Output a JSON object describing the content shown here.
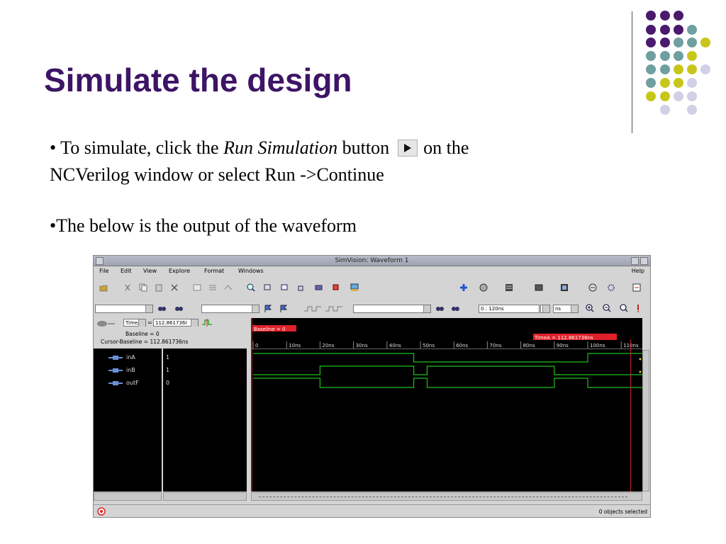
{
  "slide": {
    "title": "Simulate the design",
    "bullet1": {
      "prefix": "• To simulate, click the ",
      "emphasis": "Run Simulation",
      "middle": " button",
      "suffix": "on the",
      "line2": "NCVerilog window or select Run ->Continue"
    },
    "bullet2": "•The below is the output of the waveform"
  },
  "window": {
    "title": "SimVision: Waveform 1",
    "menus": [
      "File",
      "Edit",
      "View",
      "Explore",
      "Format",
      "Windows"
    ],
    "help": "Help",
    "time_range": "0 : 120ns",
    "time_unit": "ns",
    "cursor_select": "TimeA",
    "cursor_value": "112.861736r",
    "baseline_row": "Baseline = 0",
    "cursor_baseline_row": "Cursor-Baseline = 112.861736ns",
    "baseline_flag": "Baseline = 0",
    "timea_flag": "TimeA = 112.861736ns",
    "ticks": [
      "0",
      "10ns",
      "20ns",
      "30ns",
      "40ns",
      "50ns",
      "60ns",
      "70ns",
      "80ns",
      "90ns",
      "100ns",
      "110ns"
    ],
    "signals": [
      {
        "name": "inA",
        "value": "1"
      },
      {
        "name": "inB",
        "value": "1"
      },
      {
        "name": "outF",
        "value": "0"
      }
    ],
    "status": "0 objects selected"
  },
  "colors": {
    "title": "#3d1466",
    "dot_purple": "#4a1a6e",
    "dot_teal": "#6f9fa0",
    "dot_yellow": "#c8c61a",
    "dot_lavender": "#d0d0e6",
    "wave": "#1fc01f",
    "cursor": "#e0202a"
  }
}
